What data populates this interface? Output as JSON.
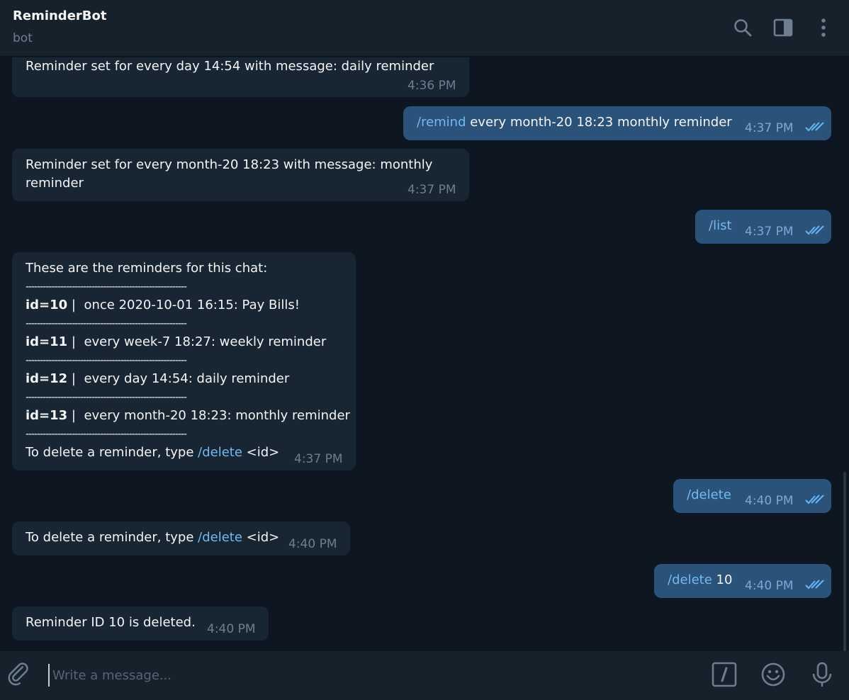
{
  "header": {
    "title": "ReminderBot",
    "subtitle": "bot",
    "icons": [
      "search-icon",
      "side-panel-icon",
      "more-vertical-icon"
    ]
  },
  "messages": [
    {
      "dir": "in",
      "text": "Reminder set for every day 14:54 with message: daily reminder",
      "time": "4:36 PM"
    },
    {
      "dir": "out",
      "command": "/remind",
      "text": " every month-20 18:23 monthly reminder",
      "time": "4:37 PM",
      "status": "read"
    },
    {
      "dir": "in",
      "line1": "Reminder set for every month-20 18:23 with message: monthly",
      "line2": "reminder",
      "time": "4:37 PM"
    },
    {
      "dir": "out",
      "command": "/list",
      "time": "4:37 PM",
      "status": "read"
    },
    {
      "dir": "in",
      "heading": "These are the reminders for this chat:",
      "separator": "--------------------------------------------------------",
      "reminders": [
        {
          "id": "id=10",
          "pipe": "|",
          "text": "once 2020-10-01 16:15: Pay Bills!"
        },
        {
          "id": "id=11",
          "pipe": "|",
          "text": "every week-7 18:27: weekly reminder"
        },
        {
          "id": "id=12",
          "pipe": "|",
          "text": "every day 14:54: daily reminder"
        },
        {
          "id": "id=13",
          "pipe": "|",
          "text": "every month-20 18:23: monthly reminder"
        }
      ],
      "footer_prefix": "To delete a reminder, type ",
      "footer_command": "/delete",
      "footer_suffix": " <id>",
      "time": "4:37 PM"
    },
    {
      "dir": "out",
      "command": "/delete",
      "time": "4:40 PM",
      "status": "read"
    },
    {
      "dir": "in",
      "prefix": "To delete a reminder, type ",
      "command": "/delete",
      "suffix": " <id>",
      "time": "4:40 PM"
    },
    {
      "dir": "out",
      "command": "/delete",
      "text": " 10",
      "time": "4:40 PM",
      "status": "read"
    },
    {
      "dir": "in",
      "text": "Reminder ID 10 is deleted.",
      "time": "4:40 PM"
    }
  ],
  "compose": {
    "placeholder": "Write a message...",
    "icons": [
      "attach-icon",
      "bot-commands-icon",
      "emoji-icon",
      "microphone-icon"
    ]
  },
  "colors": {
    "background": "#0e1621",
    "header": "#17212b",
    "incoming_bubble": "#182533",
    "outgoing_bubble": "#2b5278",
    "command_link": "#71baf3"
  }
}
